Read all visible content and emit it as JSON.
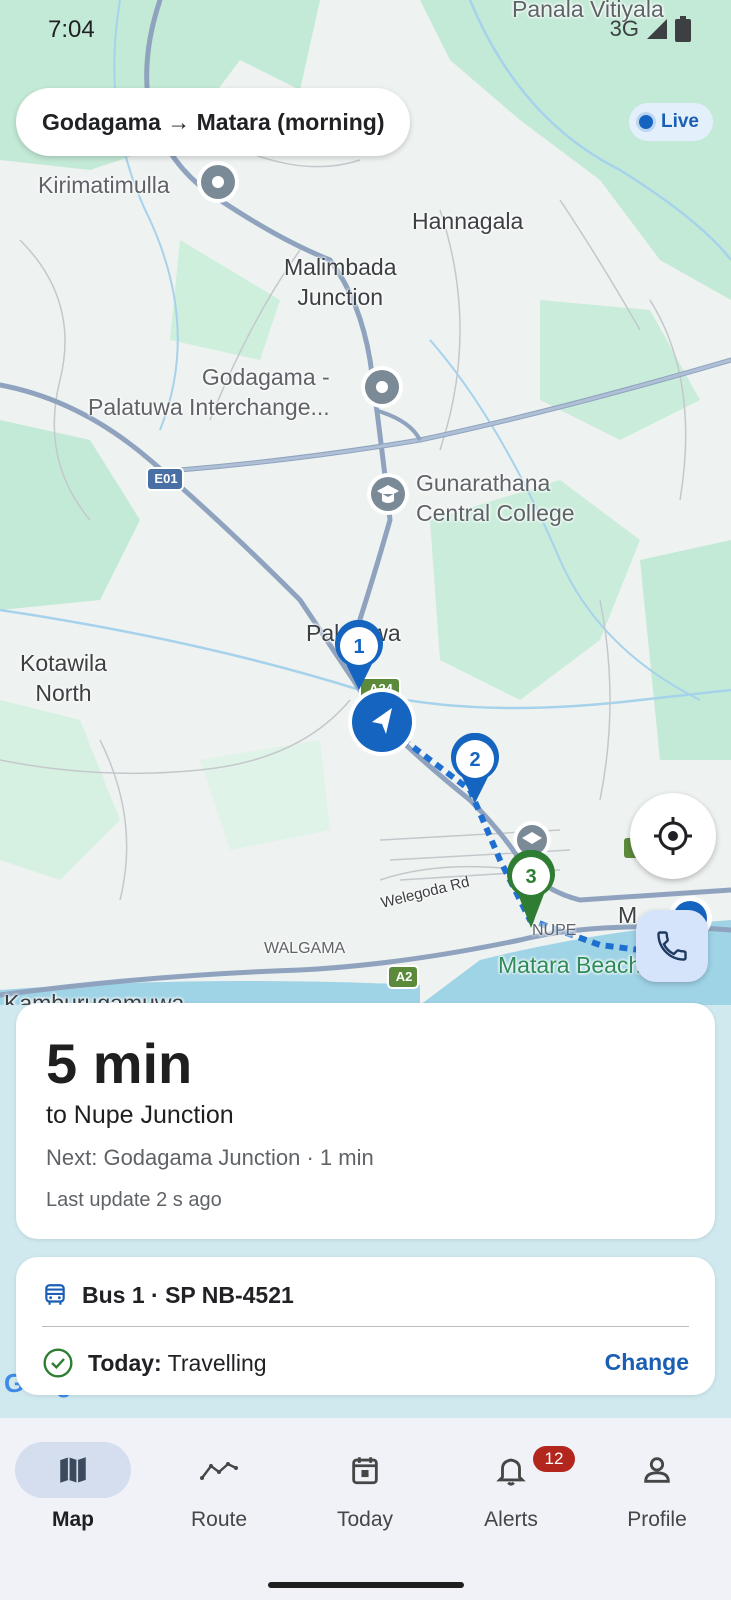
{
  "status_bar": {
    "time": "7:04",
    "network": "3G"
  },
  "route": {
    "title": "Godagama → Matara (morning)"
  },
  "live": {
    "label": "Live"
  },
  "map_labels": {
    "top_place": "Panala Vitiyala",
    "kirimatimulla": "Kirimatimulla",
    "hannagala": "Hannagala",
    "malimbada": "Malimbada\nJunction",
    "interchange": "Godagama -\nPalatuwa Interchange...",
    "college": "Gunarathana\nCentral College",
    "palatuwa": "Palatuwa",
    "kotawila": "Kotawila\nNorth",
    "welegoda": "Welegoda Rd",
    "walgama": "WALGAMA",
    "nupe": "NUPE",
    "matara_beach": "Matara Beach",
    "m_label": "M",
    "kamburugamuwa": "Kamburugamuwa",
    "e01": "E01",
    "a2": "A2",
    "a24": "A24",
    "google": "Google"
  },
  "stops": [
    {
      "number": "1"
    },
    {
      "number": "2"
    },
    {
      "number": "3"
    }
  ],
  "eta": {
    "time": "5 min",
    "destination": "to Nupe Junction",
    "next": "Next: Godagama Junction · 1 min",
    "last_update": "Last update 2 s ago"
  },
  "bus": {
    "label": "Bus 1 · SP NB-4521",
    "today_label": "Today:",
    "today_status": "Travelling",
    "change_label": "Change"
  },
  "nav": {
    "items": [
      {
        "label": "Map",
        "icon": "map-icon",
        "active": true
      },
      {
        "label": "Route",
        "icon": "route-icon"
      },
      {
        "label": "Today",
        "icon": "calendar-icon"
      },
      {
        "label": "Alerts",
        "icon": "bell-icon",
        "badge": "12"
      },
      {
        "label": "Profile",
        "icon": "person-icon"
      }
    ]
  },
  "colors": {
    "accent": "#1a5fb4",
    "stop_blue": "#1565c0",
    "stop_green": "#2e7d32",
    "badge": "#b3261e",
    "map_green": "#bfe8d2"
  }
}
